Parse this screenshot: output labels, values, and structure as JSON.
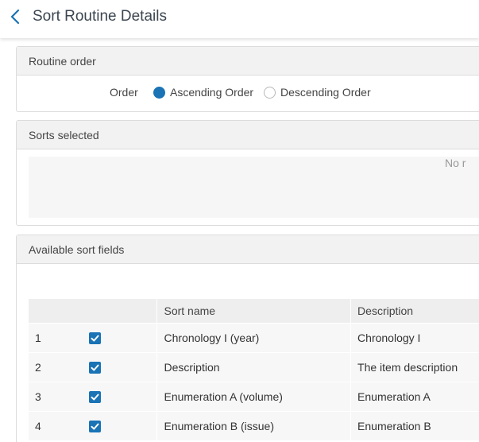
{
  "header": {
    "title": "Sort Routine Details"
  },
  "routine_order": {
    "section_title": "Routine order",
    "order_label": "Order",
    "options": [
      {
        "label": "Ascending Order",
        "selected": true
      },
      {
        "label": "Descending Order",
        "selected": false
      }
    ]
  },
  "sorts_selected": {
    "section_title": "Sorts selected",
    "empty_text": "No r"
  },
  "available_fields": {
    "section_title": "Available sort fields",
    "columns": [
      "Sort name",
      "Description"
    ],
    "rows": [
      {
        "num": "1",
        "checked": true,
        "name": "Chronology I (year)",
        "description": "Chronology I"
      },
      {
        "num": "2",
        "checked": true,
        "name": "Description",
        "description": "The item description"
      },
      {
        "num": "3",
        "checked": true,
        "name": "Enumeration A (volume)",
        "description": "Enumeration A"
      },
      {
        "num": "4",
        "checked": true,
        "name": "Enumeration B (issue)",
        "description": "Enumeration B"
      }
    ]
  },
  "colors": {
    "accent": "#1a73b5",
    "header_bg": "#f2f2f2"
  },
  "icons": {
    "back": "chevron-left-icon",
    "check": "checkmark-icon"
  }
}
